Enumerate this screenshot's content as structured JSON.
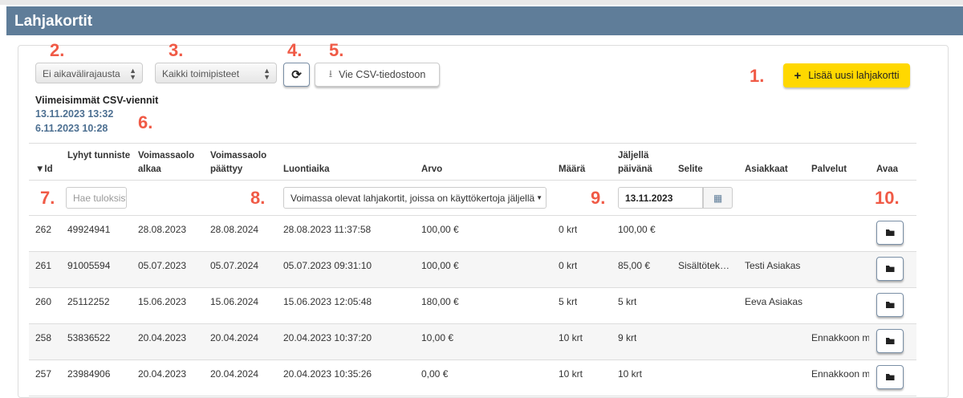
{
  "header": {
    "title": "Lahjakortit"
  },
  "annotations": [
    "1.",
    "2.",
    "3.",
    "4.",
    "5.",
    "6.",
    "7.",
    "8.",
    "9.",
    "10."
  ],
  "toolbar": {
    "date_range": "Ei aikavälirajausta",
    "location": "Kaikki toimipisteet",
    "refresh_icon": "refresh-icon",
    "csv_label": "Vie CSV-tiedostoon",
    "add_label": "Lisää uusi lahjakortti"
  },
  "csv_exports": {
    "title": "Viimeisimmät CSV-viennit",
    "items": [
      "13.11.2023 13:32",
      "6.11.2023 10:28"
    ]
  },
  "table": {
    "headers": [
      "▼Id",
      "Lyhyt tunniste",
      "Voimassaolo alkaa",
      "Voimassaolo päättyy",
      "Luontiaika",
      "Arvo",
      "Määrä",
      "Jäljellä päivänä",
      "Selite",
      "Asiakkaat",
      "Palvelut",
      "Avaa"
    ],
    "filters": {
      "search_placeholder": "Hae tuloksista",
      "status": "Voimassa olevat lahjakortit, joissa on käyttökertoja jäljellä",
      "date": "13.11.2023"
    },
    "rows": [
      [
        "262",
        "49924941",
        "28.08.2023",
        "28.08.2024",
        "28.08.2023 11:37:58",
        "100,00 €",
        "0 krt",
        "100,00 €",
        "",
        "",
        ""
      ],
      [
        "261",
        "91005594",
        "05.07.2023",
        "05.07.2024",
        "05.07.2023 09:31:10",
        "100,00 €",
        "0 krt",
        "85,00 €",
        "Sisältötek…",
        "Testi Asiakas",
        ""
      ],
      [
        "260",
        "25112252",
        "15.06.2023",
        "15.06.2024",
        "15.06.2023 12:05:48",
        "180,00 €",
        "5 krt",
        "5 krt",
        "",
        "Eeva Asiakas",
        ""
      ],
      [
        "258",
        "53836522",
        "20.04.2023",
        "20.04.2024",
        "20.04.2023 10:37:20",
        "10,00 €",
        "10 krt",
        "9 krt",
        "",
        "",
        "Ennakkoon m"
      ],
      [
        "257",
        "23984906",
        "20.04.2023",
        "20.04.2024",
        "20.04.2023 10:35:26",
        "0,00 €",
        "10 krt",
        "10 krt",
        "",
        "",
        "Ennakkoon m"
      ]
    ]
  }
}
